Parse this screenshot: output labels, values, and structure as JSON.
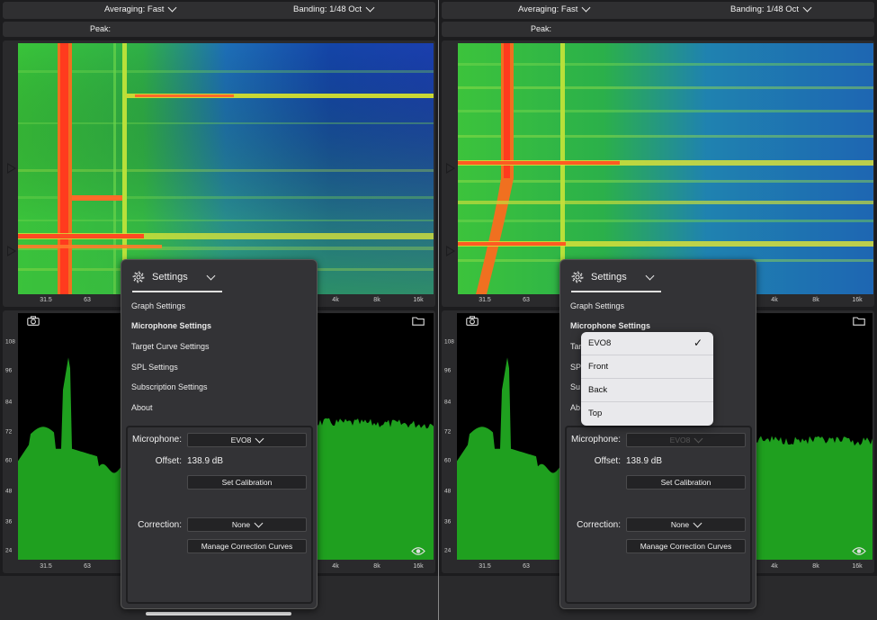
{
  "panes": [
    {
      "id": "left",
      "header": {
        "averaging": "Averaging: Fast",
        "banding": "Banding: 1/48 Oct",
        "peak": "Peak:"
      },
      "rta_fill_color": "#1fa01f",
      "rta_plateau_level": 0.56
    },
    {
      "id": "right",
      "header": {
        "averaging": "Averaging: Fast",
        "banding": "Banding: 1/48 Oct",
        "peak": "Peak:"
      },
      "rta_fill_color": "#1fa01f",
      "rta_plateau_level": 0.49
    }
  ],
  "x_ticks": [
    "31.5",
    "63",
    "4k",
    "8k",
    "16k"
  ],
  "y_ticks": [
    "108",
    "96",
    "84",
    "72",
    "60",
    "48",
    "36",
    "24"
  ],
  "settings": {
    "title": "Settings",
    "menu": [
      "Graph Settings",
      "Microphone Settings",
      "Target Curve Settings",
      "SPL Settings",
      "Subscription Settings",
      "About"
    ],
    "menu_partial_right": [
      "Tar",
      "SP",
      "Su",
      "Ab"
    ],
    "microphone_label": "Microphone:",
    "microphone_value": "EVO8",
    "offset_label": "Offset:",
    "offset_value": "138.9 dB",
    "set_calibration": "Set Calibration",
    "correction_label": "Correction:",
    "correction_value": "None",
    "manage_curves": "Manage Correction Curves"
  },
  "microphone_dropdown": {
    "options": [
      "EVO8",
      "Front",
      "Back",
      "Top"
    ],
    "selected": "EVO8"
  },
  "colors": {
    "background": "#1c1c1e",
    "panel": "#2f2f31",
    "popover": "#333336",
    "rta_green": "#1fa01f",
    "spectrogram_hot": "#ff5a1a",
    "spectrogram_cold": "#0b3a9e"
  },
  "icons": [
    "chevron-down-icon",
    "gear-icon",
    "camera-icon",
    "folder-icon",
    "eye-icon",
    "play-marker-icon",
    "checkmark-icon"
  ]
}
